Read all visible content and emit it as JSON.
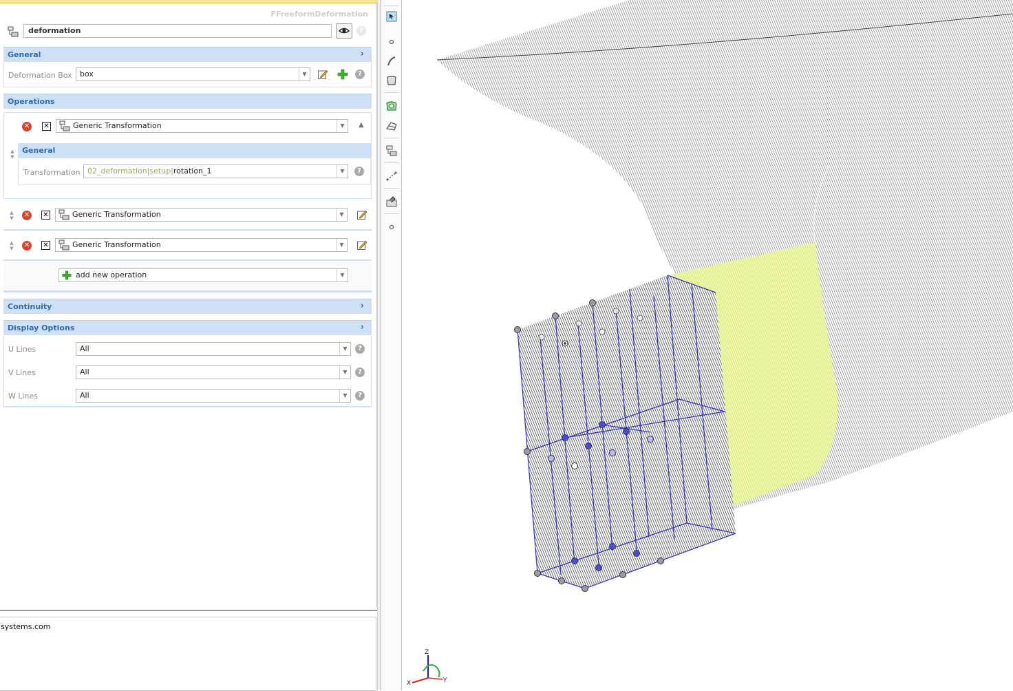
{
  "panel": {
    "class_label": "FFreeformDeformation",
    "name_value": "deformation"
  },
  "sections": {
    "general": "General",
    "operations": "Operations",
    "continuity": "Continuity",
    "display_options": "Display Options"
  },
  "general": {
    "deformation_box_label": "Deformation Box",
    "deformation_box_value": "box"
  },
  "operations": {
    "items": [
      {
        "label": "Generic Transformation"
      },
      {
        "label": "Generic Transformation"
      },
      {
        "label": "Generic Transformation"
      }
    ],
    "sub_general_title": "General",
    "transformation_label": "Transformation",
    "transformation_prefix": "02_deformation|setup|",
    "transformation_value": "rotation_1",
    "add_new": "add new operation"
  },
  "display": {
    "u_label": "U Lines",
    "u_value": "All",
    "v_label": "V Lines",
    "v_value": "All",
    "w_label": "W Lines",
    "w_value": "All"
  },
  "lower": {
    "text": "systems.com"
  },
  "axis": {
    "z": "Z",
    "x": "X",
    "y": "Y"
  },
  "colors": {
    "section_bg": "#cfe0f4",
    "section_text": "#2e6bb8",
    "control_points": "#1a1acc",
    "surface_highlight": "#e9f59a"
  }
}
